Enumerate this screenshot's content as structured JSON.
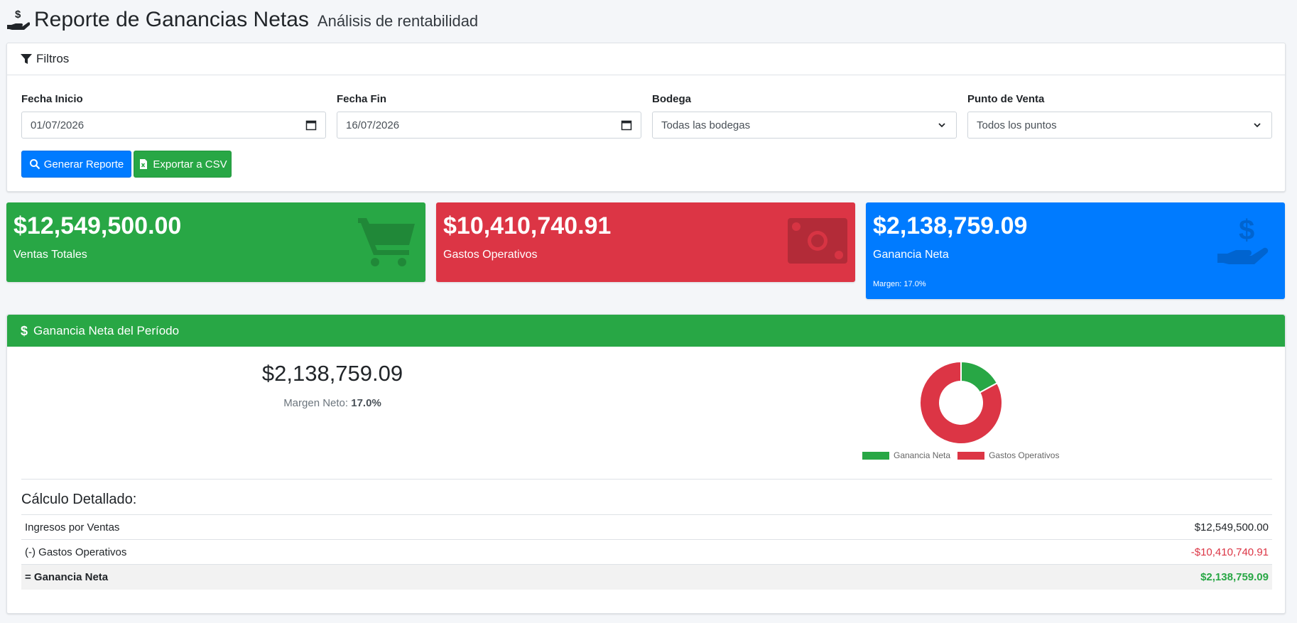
{
  "header": {
    "title": "Reporte de Ganancias Netas",
    "subtitle": "Análisis de rentabilidad",
    "icon": "hand-holding-dollar-icon"
  },
  "filters": {
    "title": "Filtros",
    "fecha_inicio": {
      "label": "Fecha Inicio",
      "value": "01/07/2026"
    },
    "fecha_fin": {
      "label": "Fecha Fin",
      "value": "16/07/2026"
    },
    "bodega": {
      "label": "Bodega",
      "selected": "Todas las bodegas"
    },
    "punto_venta": {
      "label": "Punto de Venta",
      "selected": "Todos los puntos"
    },
    "generate_label": "Generar Reporte",
    "export_label": "Exportar a CSV"
  },
  "stats": {
    "ventas": {
      "value": "$12,549,500.00",
      "label": "Ventas Totales",
      "color": "#28a745",
      "icon": "shopping-cart-icon"
    },
    "gastos": {
      "value": "$10,410,740.91",
      "label": "Gastos Operativos",
      "color": "#dc3545",
      "icon": "money-bill-icon"
    },
    "ganancia": {
      "value": "$2,138,759.09",
      "label": "Ganancia Neta",
      "sub": "Margen: 17.0%",
      "color": "#007bff",
      "icon": "hand-holding-dollar-icon"
    }
  },
  "profit_section": {
    "title": "Ganancia Neta del Período",
    "amount": "$2,138,759.09",
    "margin_label": "Margen Neto:",
    "margin_value": "17.0%"
  },
  "chart_data": {
    "type": "pie",
    "donut": true,
    "labels": [
      "Ganancia Neta",
      "Gastos Operativos"
    ],
    "values": [
      2138759.09,
      10410740.91
    ],
    "colors": [
      "#28a745",
      "#dc3545"
    ],
    "legend_position": "bottom"
  },
  "calc": {
    "title": "Cálculo Detallado:",
    "rows": [
      {
        "label": "Ingresos por Ventas",
        "amount": "$12,549,500.00",
        "color": "#212529"
      },
      {
        "label": "(-) Gastos Operativos",
        "amount": "-$10,410,740.91",
        "color": "#dc3545"
      },
      {
        "label": "= Ganancia Neta",
        "amount": "$2,138,759.09",
        "color": "#28a745"
      }
    ]
  }
}
